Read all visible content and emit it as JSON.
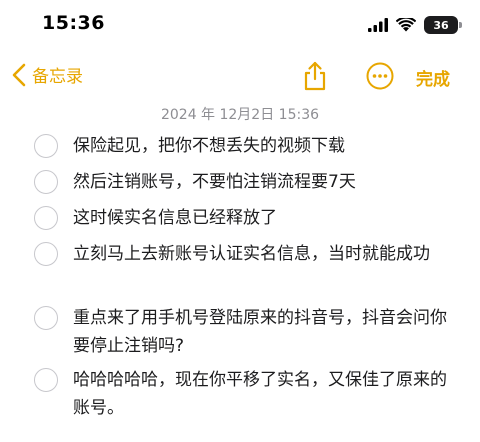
{
  "status_bar": {
    "time": "15:36",
    "battery_level": "36"
  },
  "nav": {
    "back_label": "备忘录",
    "done_label": "完成",
    "accent_color": "#e7a600",
    "icons": [
      "chevron-left-icon",
      "share-icon",
      "more-icon"
    ]
  },
  "note": {
    "date": "2024 年 12月2日 15:36",
    "checklist": [
      {
        "text": "保险起见，把你不想丢失的视频下载",
        "checked": false
      },
      {
        "text": "然后注销账号，不要怕注销流程要7天",
        "checked": false
      },
      {
        "text": "这时候实名信息已经释放了",
        "checked": false
      },
      {
        "text": "立刻马上去新账号认证实名信息，当时就能成功",
        "checked": false
      },
      {
        "text": "重点来了用手机号登陆原来的抖音号，抖音会问你要停止注销吗?",
        "checked": false
      },
      {
        "text": "哈哈哈哈哈，现在你平移了实名，又保佳了原来的账号。",
        "checked": false
      }
    ]
  }
}
